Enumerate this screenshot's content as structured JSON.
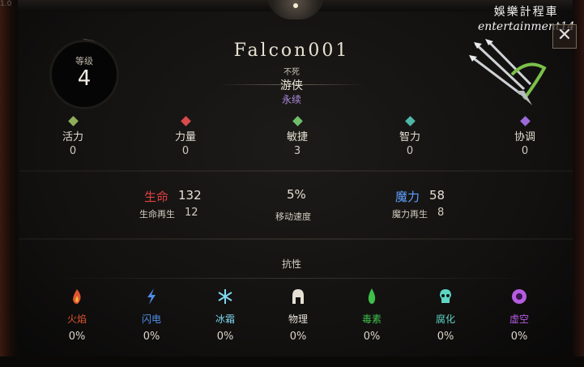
{
  "corner_label": "1.0",
  "watermark": {
    "line1": "娛樂計程車",
    "line2": "entertainment14"
  },
  "close_label": "✕",
  "level": {
    "label": "等级",
    "value": "4"
  },
  "character": {
    "name": "Falcon001",
    "status": "不死",
    "class": "游侠",
    "mode": "永续"
  },
  "attributes": [
    {
      "label": "活力",
      "value": "0",
      "color": "#8fae5a"
    },
    {
      "label": "力量",
      "value": "0",
      "color": "#d94a4a"
    },
    {
      "label": "敏捷",
      "value": "3",
      "color": "#6fbf6a"
    },
    {
      "label": "智力",
      "value": "0",
      "color": "#4fb7a8"
    },
    {
      "label": "协调",
      "value": "0",
      "color": "#9b6ad8"
    }
  ],
  "vitals": {
    "life_label": "生命",
    "life_value": "132",
    "life_regen_label": "生命再生",
    "life_regen_value": "12",
    "move_value": "5%",
    "move_label": "移动速度",
    "mana_label": "魔力",
    "mana_value": "58",
    "mana_regen_label": "魔力再生",
    "mana_regen_value": "8"
  },
  "resistances_title": "抗性",
  "resistances": [
    {
      "label": "火焰",
      "value": "0%",
      "color": "#e0552f",
      "icon": "fire-icon"
    },
    {
      "label": "闪电",
      "value": "0%",
      "color": "#4f8fe8",
      "icon": "lightning-icon"
    },
    {
      "label": "冰霜",
      "value": "0%",
      "color": "#7fd6f0",
      "icon": "snowflake-icon"
    },
    {
      "label": "物理",
      "value": "0%",
      "color": "#e6e0d4",
      "icon": "helmet-icon"
    },
    {
      "label": "毒素",
      "value": "0%",
      "color": "#3fbf4a",
      "icon": "poison-drop-icon"
    },
    {
      "label": "腐化",
      "value": "0%",
      "color": "#5fd6c4",
      "icon": "skull-icon"
    },
    {
      "label": "虚空",
      "value": "0%",
      "color": "#b55ce0",
      "icon": "void-orb-icon"
    }
  ]
}
